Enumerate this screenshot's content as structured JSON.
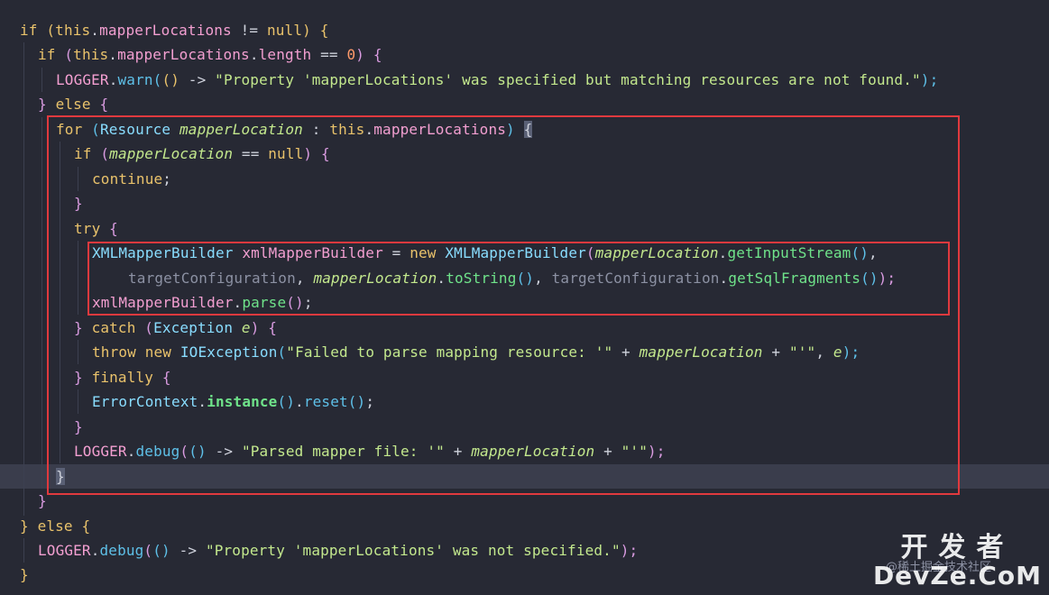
{
  "code": {
    "l1": [
      "if",
      " (",
      "this",
      ".",
      "mapperLocations",
      " != ",
      "null",
      ") {"
    ],
    "l2": [
      "if",
      " (",
      "this",
      ".",
      "mapperLocations",
      ".",
      "length",
      " == ",
      "0",
      ") {"
    ],
    "l3": [
      "LOGGER",
      ".",
      "warn",
      "(",
      "()",
      " -> ",
      "\"Property 'mapperLocations' was specified but matching resources are not found.\"",
      ");"
    ],
    "l4": [
      "} ",
      "else",
      " {"
    ],
    "l5": [
      "for",
      " (",
      "Resource",
      " ",
      "mapperLocation",
      " : ",
      "this",
      ".",
      "mapperLocations",
      ") ",
      "{"
    ],
    "l6": [
      "if",
      " (",
      "mapperLocation",
      " == ",
      "null",
      ") {"
    ],
    "l7": [
      "continue",
      ";"
    ],
    "l8": [
      "}"
    ],
    "l9": [
      "try",
      " {"
    ],
    "l10": [
      "XMLMapperBuilder",
      " ",
      "xmlMapperBuilder",
      " = ",
      "new",
      " ",
      "XMLMapperBuilder",
      "(",
      "mapperLocation",
      ".",
      "getInputStream",
      "()",
      ","
    ],
    "l11": [
      "targetConfiguration",
      ", ",
      "mapperLocation",
      ".",
      "toString",
      "()",
      ", ",
      "targetConfiguration",
      ".",
      "getSqlFragments",
      "()",
      ");"
    ],
    "l12": [
      "xmlMapperBuilder",
      ".",
      "parse",
      "()",
      ";"
    ],
    "l13": [
      "} ",
      "catch",
      " (",
      "Exception",
      " ",
      "e",
      ") {"
    ],
    "l14": [
      "throw",
      " ",
      "new",
      " ",
      "IOException",
      "(",
      "\"Failed to parse mapping resource: '\"",
      " + ",
      "mapperLocation",
      " + ",
      "\"'\"",
      ", ",
      "e",
      ");"
    ],
    "l15": [
      "} ",
      "finally",
      " {"
    ],
    "l16": [
      "ErrorContext",
      ".",
      "instance",
      "()",
      ".",
      "reset",
      "()",
      ";"
    ],
    "l17": [
      "}"
    ],
    "l18": [
      "LOGGER",
      ".",
      "debug",
      "(",
      "()",
      " -> ",
      "\"Parsed mapper file: '\"",
      " + ",
      "mapperLocation",
      " + ",
      "\"'\"",
      ");"
    ],
    "l19": [
      "}"
    ],
    "l20": [
      "}"
    ],
    "l21": [
      "} ",
      "else",
      " {"
    ],
    "l22": [
      "LOGGER",
      ".",
      "debug",
      "(",
      "()",
      " -> ",
      "\"Property 'mapperLocations' was not specified.\"",
      ");"
    ],
    "l23": [
      "}"
    ]
  },
  "watermark": {
    "cn": "开发者",
    "en": "DevZe.CoM",
    "sub": "@稀土掘金技术社区"
  },
  "colors": {
    "background": "#272934",
    "highlight_box": "#e0393e",
    "keyword": "#e9c26b",
    "string": "#c3e88d"
  }
}
